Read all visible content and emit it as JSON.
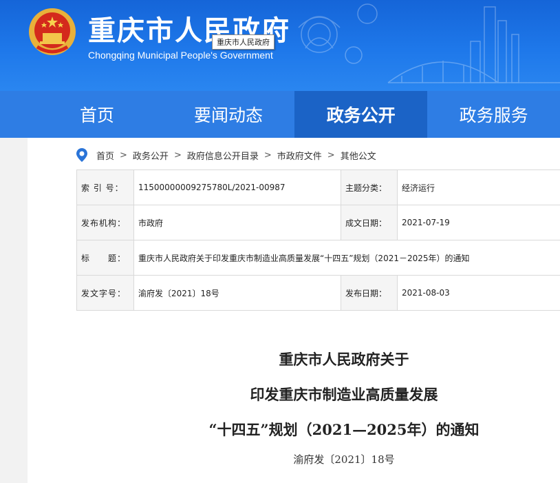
{
  "header": {
    "title": "重庆市人民政府",
    "subtitle": "Chongqing Municipal People's Government",
    "tooltip": "重庆市人民政府"
  },
  "nav": {
    "items": [
      {
        "label": "首页"
      },
      {
        "label": "要闻动态"
      },
      {
        "label": "政务公开"
      },
      {
        "label": "政务服务"
      }
    ],
    "active_index": 2
  },
  "breadcrumb": {
    "items": [
      "首页",
      "政务公开",
      "政府信息公开目录",
      "市政府文件",
      "其他公文"
    ],
    "separator": ">"
  },
  "info": {
    "index_label": "索 引 号：",
    "index_value": "11500000009275780L/2021-00987",
    "category_label": "主题分类：",
    "category_value": "经济运行",
    "issuer_label": "发布机构：",
    "issuer_value": "市政府",
    "created_label": "成文日期：",
    "created_value": "2021-07-19",
    "title_label": "标　　题：",
    "title_value": "重庆市人民政府关于印发重庆市制造业高质量发展“十四五”规划（2021－2025年）的通知",
    "docno_label": "发文字号：",
    "docno_value": "渝府发〔2021〕18号",
    "published_label": "发布日期：",
    "published_value": "2021-08-03"
  },
  "document": {
    "title_line1": "重庆市人民政府关于",
    "title_line2": "印发重庆市制造业高质量发展",
    "title_line3": "“十四五”规划（2021—2025年）的通知",
    "doc_number": "渝府发〔2021〕18号"
  },
  "colors": {
    "header_blue": "#1e78ea",
    "nav_blue": "#2e7de4",
    "nav_active": "#1b63c6"
  }
}
